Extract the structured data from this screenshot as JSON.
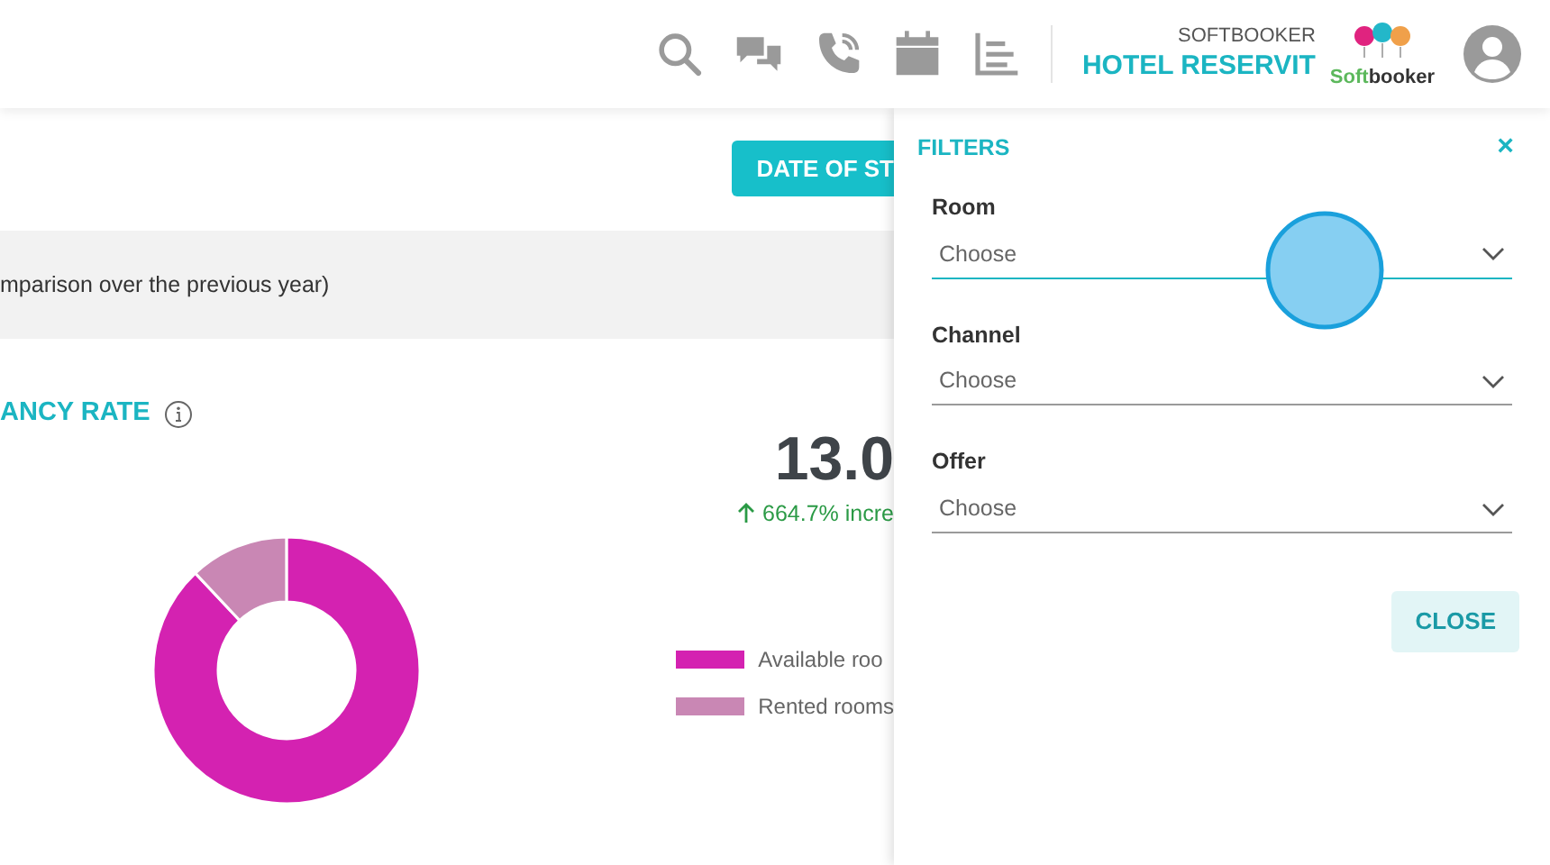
{
  "header": {
    "subtitle": "SOFTBOOKER",
    "title": "HOTEL RESERVIT",
    "logo_parts": [
      "Soft",
      "booker"
    ]
  },
  "toolbar": {
    "date_button": "DATE OF ST"
  },
  "info_band": {
    "text": "mparison over the previous year)"
  },
  "occupancy": {
    "title": "ANCY RATE",
    "value": "13.0",
    "change": "664.7% incre",
    "legend": [
      {
        "label": "Available roo",
        "color": "#d422b1"
      },
      {
        "label": "Rented rooms",
        "color": "#c987b4"
      }
    ]
  },
  "filters": {
    "title": "FILTERS",
    "close_icon": "×",
    "fields": [
      {
        "label": "Room",
        "value": "Choose",
        "focused": true
      },
      {
        "label": "Channel",
        "value": "Choose",
        "focused": false
      },
      {
        "label": "Offer",
        "value": "Choose",
        "focused": false
      }
    ],
    "close_button": "CLOSE"
  }
}
